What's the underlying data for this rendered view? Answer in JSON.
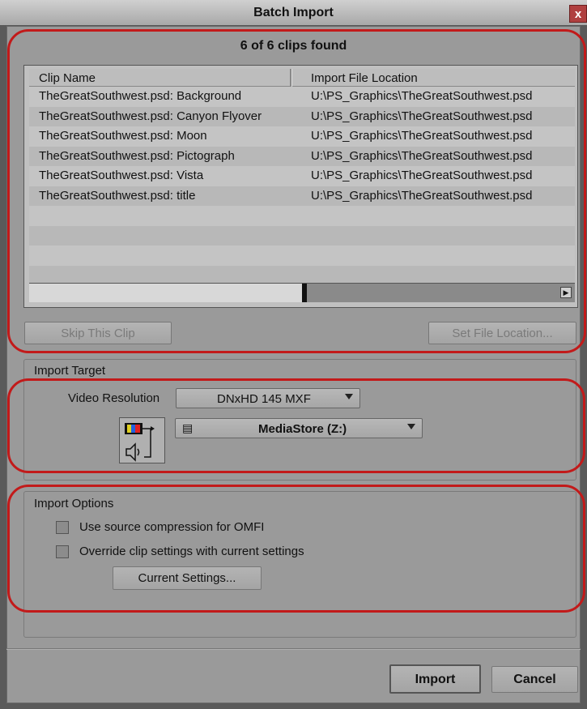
{
  "window": {
    "title": "Batch Import",
    "close_glyph": "x"
  },
  "clips": {
    "found_label": "6 of 6 clips found",
    "columns": [
      "Clip Name",
      "Import File Location"
    ],
    "rows": [
      {
        "name": "TheGreatSouthwest.psd: Background",
        "location": "U:\\PS_Graphics\\TheGreatSouthwest.psd"
      },
      {
        "name": "TheGreatSouthwest.psd: Canyon Flyover",
        "location": "U:\\PS_Graphics\\TheGreatSouthwest.psd"
      },
      {
        "name": "TheGreatSouthwest.psd: Moon",
        "location": "U:\\PS_Graphics\\TheGreatSouthwest.psd"
      },
      {
        "name": "TheGreatSouthwest.psd: Pictograph",
        "location": "U:\\PS_Graphics\\TheGreatSouthwest.psd"
      },
      {
        "name": "TheGreatSouthwest.psd: Vista",
        "location": "U:\\PS_Graphics\\TheGreatSouthwest.psd"
      },
      {
        "name": "TheGreatSouthwest.psd: title",
        "location": "U:\\PS_Graphics\\TheGreatSouthwest.psd"
      },
      {
        "name": "",
        "location": ""
      },
      {
        "name": "",
        "location": ""
      },
      {
        "name": "",
        "location": ""
      },
      {
        "name": "",
        "location": ""
      }
    ],
    "skip_button": "Skip This Clip",
    "set_location_button": "Set File Location..."
  },
  "import_target": {
    "label": "Import Target",
    "video_resolution_label": "Video Resolution",
    "video_resolution_value": "DNxHD 145  MXF",
    "media_drive_value": "MediaStore (Z:)",
    "icons": [
      "video-monitor-icon",
      "speaker-icon",
      "drive-icon"
    ]
  },
  "import_options": {
    "label": "Import Options",
    "option1": "Use source compression for OMFI",
    "option2": "Override clip settings with current settings",
    "current_settings_button": "Current Settings..."
  },
  "footer": {
    "import_button": "Import",
    "cancel_button": "Cancel"
  },
  "colors": {
    "highlight_outline": "#c21a1a",
    "dialog_bg": "#9a9a9a"
  }
}
